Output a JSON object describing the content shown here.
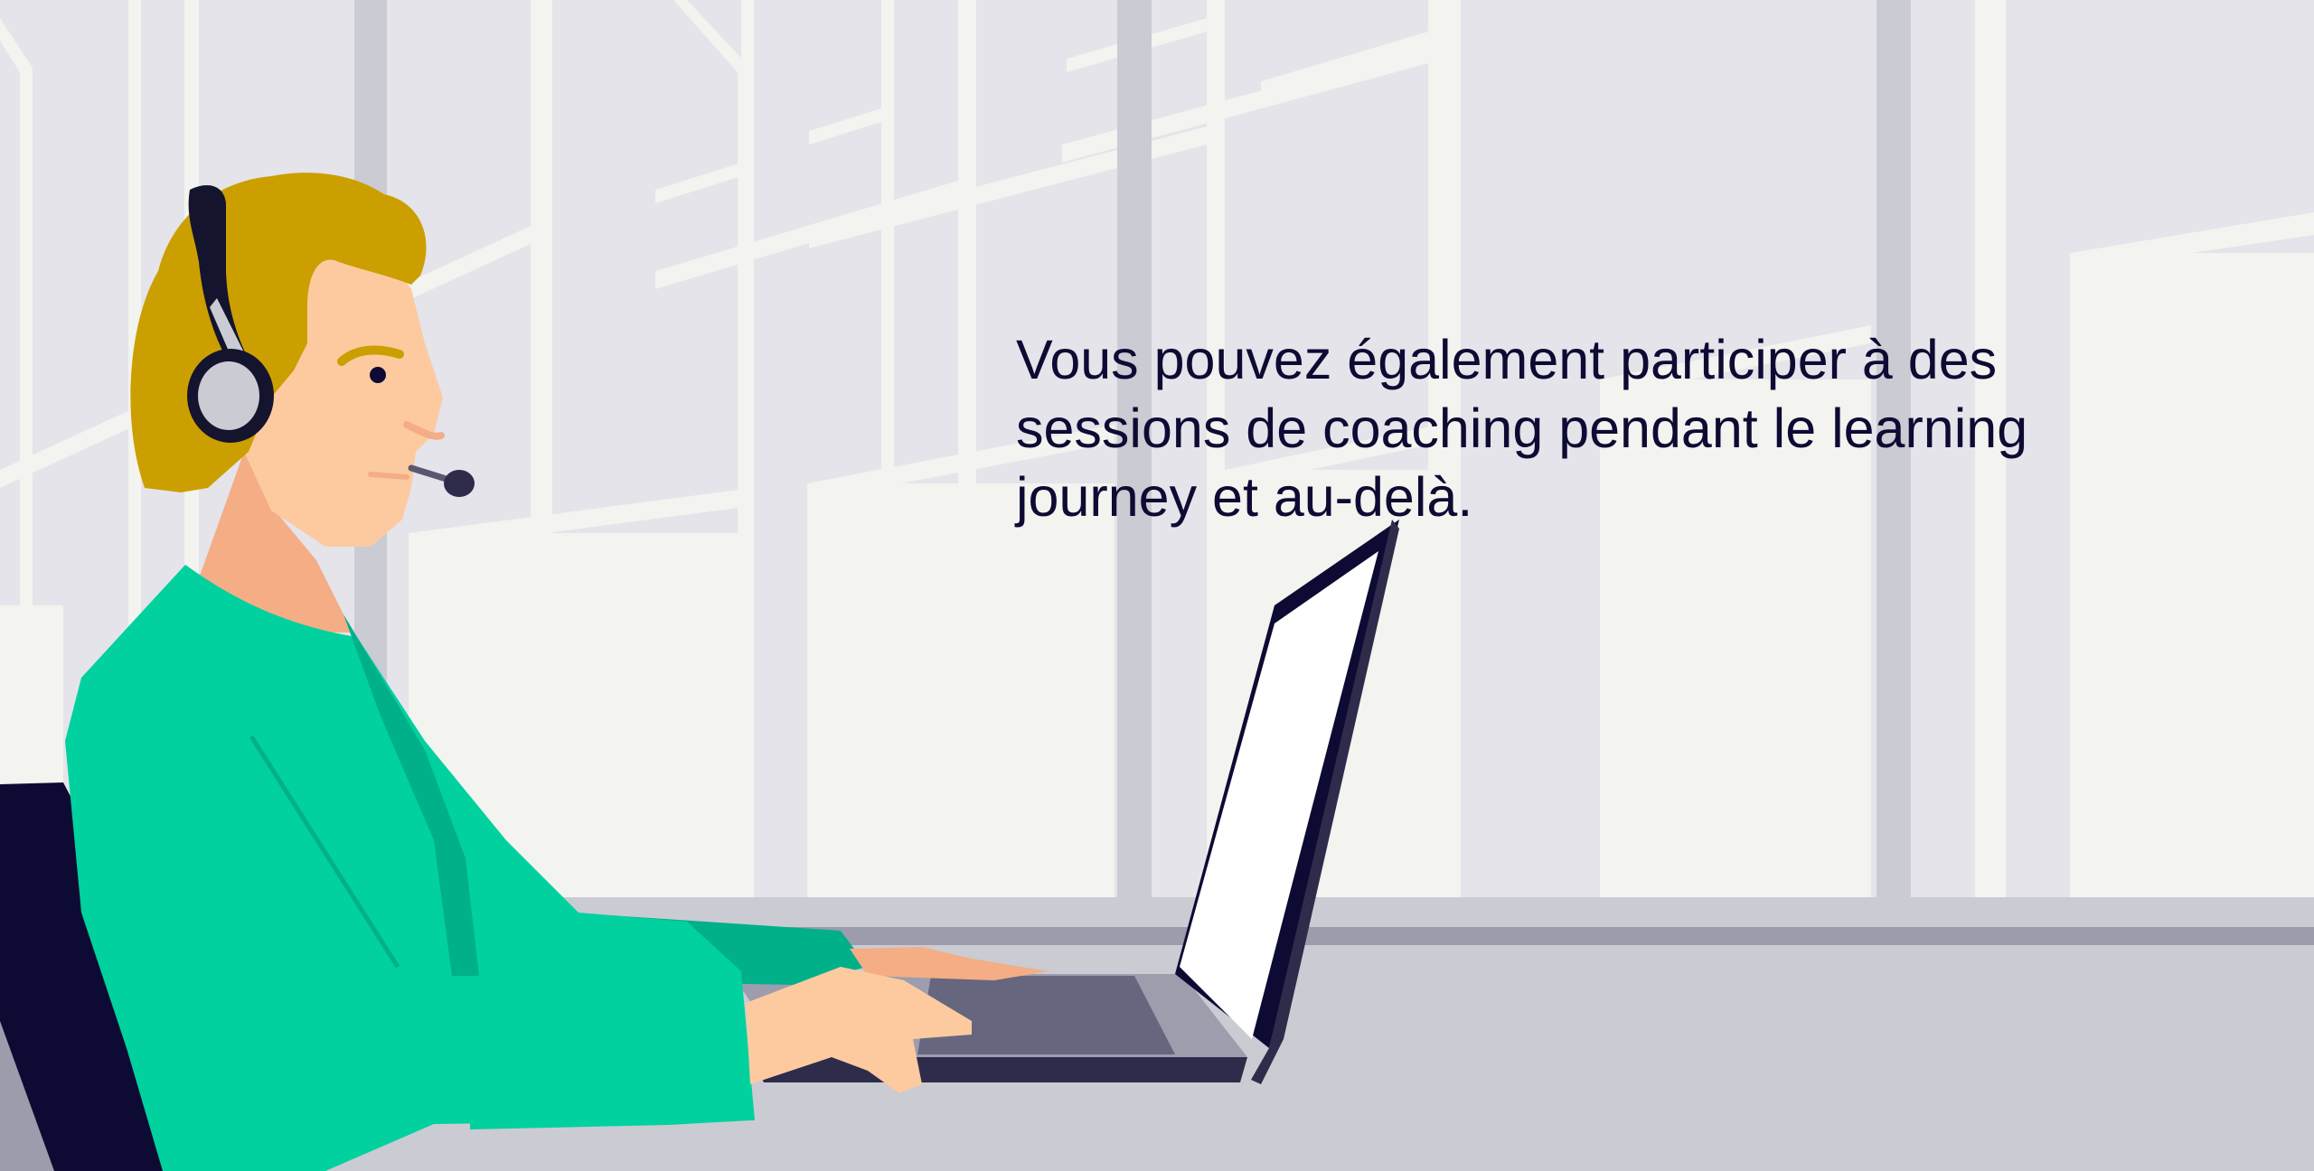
{
  "slide": {
    "caption": "Vous pouvez également participer à des sessions de coaching pendant le learning journey et au-delà."
  },
  "colors": {
    "background": "#e4e4ea",
    "window_frame": "#f3f3ef",
    "pillar": "#cbcbd3",
    "desk": "#cbcbd3",
    "desk_edge": "#9c9cac",
    "sweater": "#00d19e",
    "sweater_shadow": "#00b089",
    "skin": "#fdcaa0",
    "skin_shadow": "#f4ad85",
    "hair": "#cc9f00",
    "headset": "#14142e",
    "laptop_base": "#9d9dae",
    "laptop_dark": "#2e2c4a",
    "chair": "#0d0b33",
    "text": "#0d0b33"
  },
  "illustration": {
    "subject": "person-with-headset-typing-on-laptop",
    "icons": [
      "headset-icon",
      "laptop-icon",
      "chair-icon"
    ]
  }
}
